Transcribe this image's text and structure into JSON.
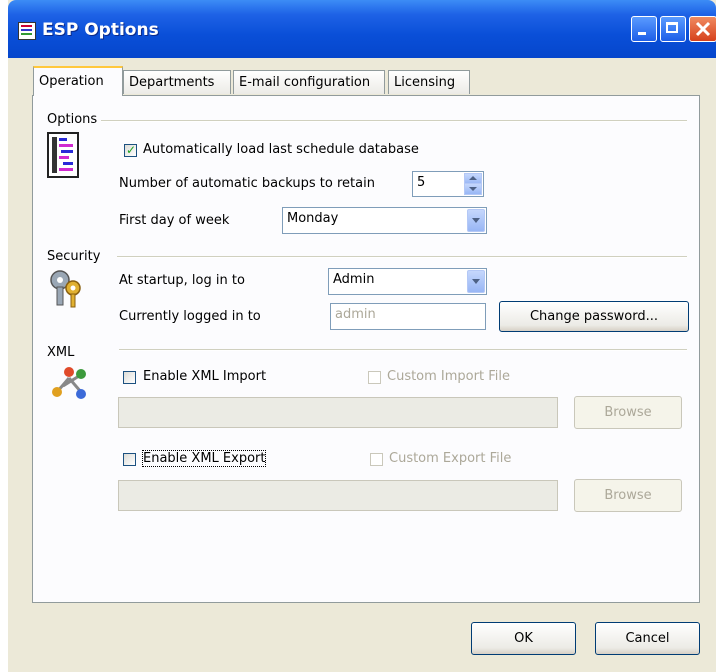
{
  "window": {
    "title": "ESP Options"
  },
  "tabs": [
    {
      "label": "Operation"
    },
    {
      "label": "Departments"
    },
    {
      "label": "E-mail configuration"
    },
    {
      "label": "Licensing"
    }
  ],
  "options": {
    "section_label": "Options",
    "auto_load_label": "Automatically load last schedule database",
    "auto_load_checked": true,
    "backups_label": "Number of automatic backups to retain",
    "backups_value": "5",
    "first_day_label": "First day of week",
    "first_day_value": "Monday"
  },
  "security": {
    "section_label": "Security",
    "startup_label": "At startup, log in to",
    "startup_value": "Admin",
    "logged_in_label": "Currently logged in to",
    "logged_in_value": "admin",
    "change_password_label": "Change password..."
  },
  "xml": {
    "section_label": "XML",
    "import_label": "Enable XML Import",
    "custom_import_label": "Custom Import File",
    "import_path": "",
    "import_browse_label": "Browse",
    "export_label": "Enable XML Export",
    "custom_export_label": "Custom Export File",
    "export_path": "",
    "export_browse_label": "Browse"
  },
  "footer": {
    "ok_label": "OK",
    "cancel_label": "Cancel"
  },
  "colors": {
    "titlebar": "#0a4fd8",
    "dialog_bg": "#ece9d8",
    "panel_bg": "#fcfcfe",
    "check": "#21a121"
  }
}
